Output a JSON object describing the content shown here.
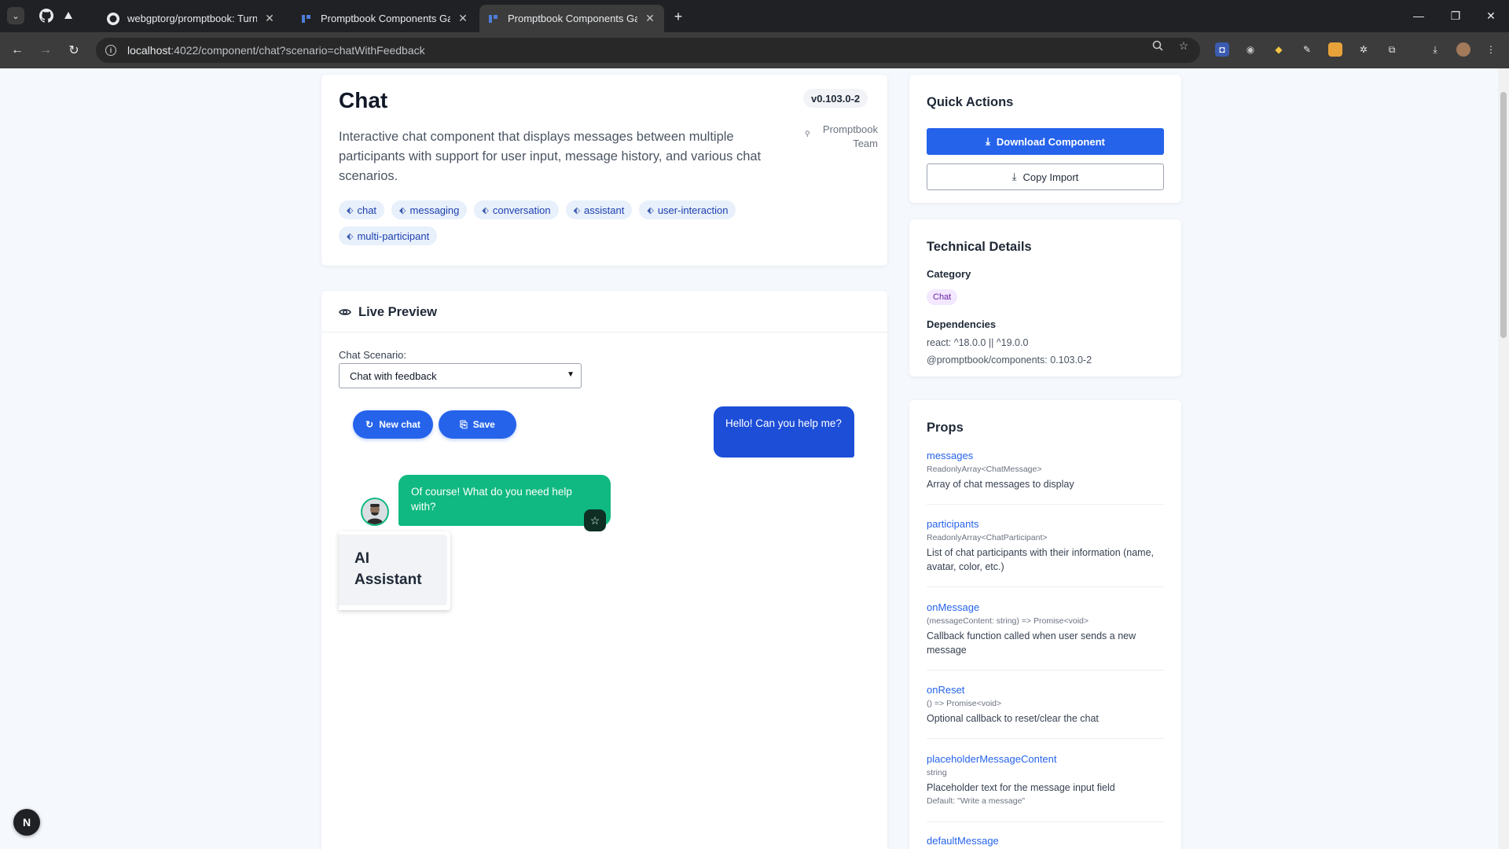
{
  "browser": {
    "tabs": [
      {
        "title": "webgptorg/promptbook: Turn y",
        "favicon": "github-icon"
      },
      {
        "title": "Promptbook Components Galle",
        "favicon": "promptbook-icon"
      },
      {
        "title": "Promptbook Components Galle",
        "favicon": "promptbook-icon",
        "active": true
      }
    ],
    "url_host": "localhost",
    "url_rest": ":4022/component/chat?scenario=chatWithFeedback"
  },
  "header": {
    "title": "Chat",
    "version": "v0.103.0-2",
    "author_line1": "Promptbook",
    "author_line2": "Team",
    "description": "Interactive chat component that displays messages between multiple participants with support for user input, message history, and various chat scenarios.",
    "tags": [
      "chat",
      "messaging",
      "conversation",
      "assistant",
      "user-interaction",
      "multi-participant"
    ]
  },
  "preview": {
    "title": "Live Preview",
    "scenario_label": "Chat Scenario:",
    "scenario_value": "Chat with feedback",
    "new_chat_label": "New chat",
    "save_label": "Save",
    "user_message": "Hello! Can you help me?",
    "ai_message": "Of course! What do you need help with?",
    "participant_tooltip": "AI Assistant"
  },
  "quick_actions": {
    "title": "Quick Actions",
    "download_label": "Download Component",
    "copy_label": "Copy Import"
  },
  "technical": {
    "title": "Technical Details",
    "category_label": "Category",
    "category_value": "Chat",
    "dependencies_label": "Dependencies",
    "dependencies": [
      "react: ^18.0.0 || ^19.0.0",
      "@promptbook/components: 0.103.0-2"
    ]
  },
  "props": {
    "title": "Props",
    "items": [
      {
        "name": "messages",
        "type": "ReadonlyArray<ChatMessage>",
        "description": "Array of chat messages to display"
      },
      {
        "name": "participants",
        "type": "ReadonlyArray<ChatParticipant>",
        "description": "List of chat participants with their information (name, avatar, color, etc.)"
      },
      {
        "name": "onMessage",
        "type": "(messageContent: string) => Promise<void>",
        "description": "Callback function called when user sends a new message"
      },
      {
        "name": "onReset",
        "type": "() => Promise<void>",
        "description": "Optional callback to reset/clear the chat"
      },
      {
        "name": "placeholderMessageContent",
        "type": "string",
        "description": "Placeholder text for the message input field",
        "default": "Default: \"Write a message\""
      },
      {
        "name": "defaultMessage"
      }
    ]
  },
  "dev_badge": "N",
  "colors": {
    "accent": "#2563eb",
    "user_bubble": "#1d4ed8",
    "ai_bubble": "#10b981",
    "tag_bg": "#e8f0fb",
    "category_bg": "#f3e8ff"
  }
}
